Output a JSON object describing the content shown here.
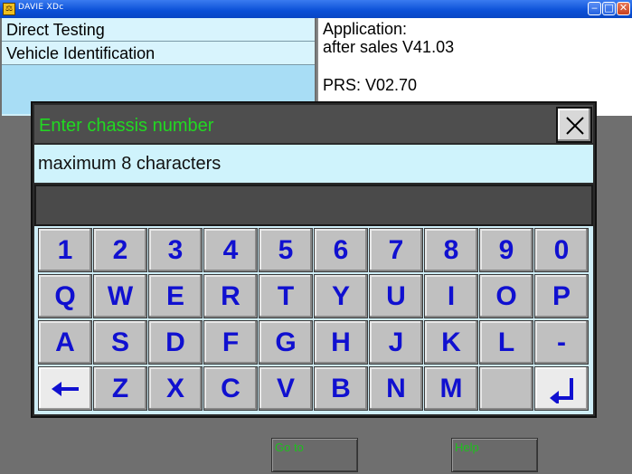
{
  "window": {
    "title": "DAVIE XDc",
    "app_icon_glyph": "⚖",
    "minimize_glyph": "‒",
    "maximize_glyph": "□",
    "close_glyph": "✕"
  },
  "menu": {
    "items": [
      {
        "label": "Direct Testing"
      },
      {
        "label": "Vehicle Identification"
      },
      {
        "label": ""
      }
    ]
  },
  "info": {
    "application_label": "Application:",
    "application_value": "after sales V41.03",
    "prs": "PRS: V02.70"
  },
  "dialog": {
    "title": "Enter chassis number",
    "hint": "maximum 8 characters",
    "entry_value": "",
    "close_icon": "close-icon",
    "keys": {
      "row1": [
        "1",
        "2",
        "3",
        "4",
        "5",
        "6",
        "7",
        "8",
        "9",
        "0"
      ],
      "row2": [
        "Q",
        "W",
        "E",
        "R",
        "T",
        "Y",
        "U",
        "I",
        "O",
        "P"
      ],
      "row3": [
        "A",
        "S",
        "D",
        "F",
        "G",
        "H",
        "J",
        "K",
        "L",
        "-"
      ],
      "row4": [
        "",
        "Z",
        "X",
        "C",
        "V",
        "B",
        "N",
        "M",
        "",
        ""
      ]
    },
    "backspace_icon": "arrow-left-icon",
    "enter_icon": "enter-return-icon"
  },
  "footer": {
    "goto_label": "Go to",
    "help_label": "Help"
  },
  "colors": {
    "title_green": "#22d822",
    "key_text_blue": "#1010d0",
    "panel_light_blue": "#cff3fc"
  }
}
